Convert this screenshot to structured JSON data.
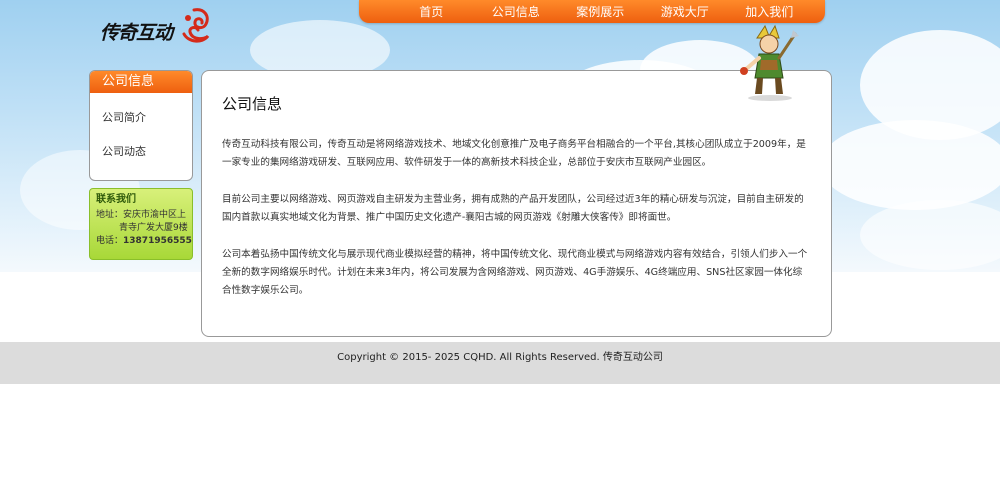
{
  "brand": {
    "logo_text": "传奇互动"
  },
  "nav": {
    "items": [
      {
        "label": "首页"
      },
      {
        "label": "公司信息"
      },
      {
        "label": "案例展示"
      },
      {
        "label": "游戏大厅"
      },
      {
        "label": "加入我们"
      }
    ]
  },
  "sidebar": {
    "title": "公司信息",
    "links": [
      {
        "label": "公司简介"
      },
      {
        "label": "公司动态"
      }
    ]
  },
  "contact": {
    "title": "联系我们",
    "address_label": "地址：",
    "address_line1": "安庆市渝中区上",
    "address_line2": "青寺广发大厦9楼",
    "phone_label": "电话：",
    "phone": "13871956555"
  },
  "main": {
    "title": "公司信息",
    "paragraphs": [
      "传奇互动科技有限公司，传奇互动是将网络游戏技术、地域文化创意推广及电子商务平台相融合的一个平台,其核心团队成立于2009年，是一家专业的集网络游戏研发、互联网应用、软件研发于一体的高新技术科技企业，总部位于安庆市互联网产业园区。",
      "目前公司主要以网络游戏、网页游戏自主研发为主营业务，拥有成熟的产品开发团队，公司经过近3年的精心研发与沉淀，目前自主研发的国内首款以真实地域文化为背景、推广中国历史文化遗产-襄阳古城的网页游戏《射雕大侠客传》即将面世。",
      "公司本着弘扬中国传统文化与展示现代商业模拟经营的精神，将中国传统文化、现代商业模式与网络游戏内容有效结合，引领人们步入一个全新的数字网络娱乐时代。计划在未来3年内，将公司发展为含网络游戏、网页游戏、4G手游娱乐、4G终端应用、SNS社区家园一体化综合性数字娱乐公司。"
    ]
  },
  "footer": {
    "copyright": "Copyright © 2015- 2025 CQHD. All Rights Reserved. 传奇互动公司"
  },
  "colors": {
    "nav_orange": "#ee5f0f",
    "contact_green": "#a8d838",
    "footer_gray": "#dcdcdc"
  },
  "icons": {
    "logo_mark": "dragon-swirl-icon",
    "hero": "hero-character-image"
  }
}
